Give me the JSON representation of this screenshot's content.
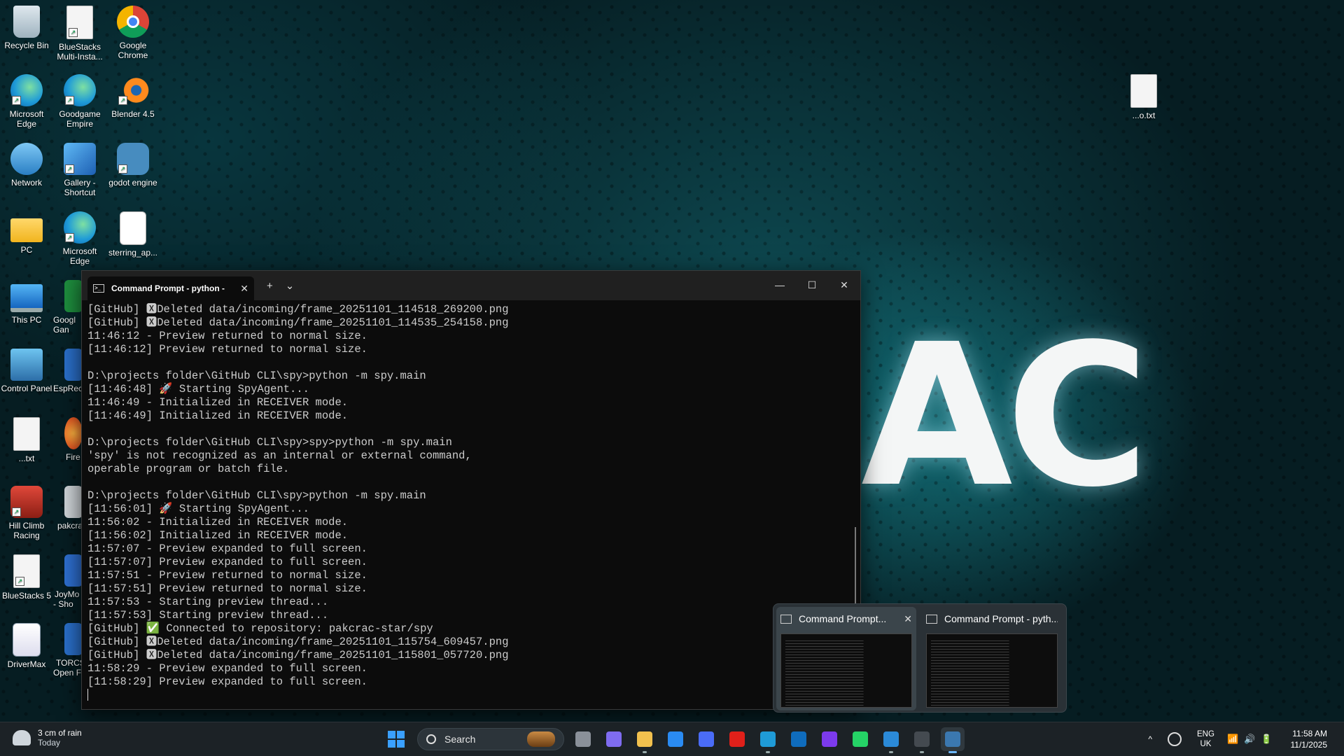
{
  "desktop": {
    "icons": [
      {
        "label": "Recycle Bin",
        "icon": "recycle-bin-icon"
      },
      {
        "label": "BlueStacks Multi-Insta...",
        "icon": "bluestacks-doc-icon"
      },
      {
        "label": "Google Chrome",
        "icon": "chrome-icon"
      },
      {
        "label": "Microsoft Edge",
        "icon": "edge-icon"
      },
      {
        "label": "Goodgame Empire",
        "icon": "edge-icon"
      },
      {
        "label": "Blender 4.5",
        "icon": "blender-icon"
      },
      {
        "label": "Network",
        "icon": "network-icon"
      },
      {
        "label": "Gallery - Shortcut",
        "icon": "gallery-icon"
      },
      {
        "label": "godot engine",
        "icon": "godot-icon"
      },
      {
        "label": "PC",
        "icon": "folder-icon"
      },
      {
        "label": "Microsoft Edge",
        "icon": "edge-icon"
      },
      {
        "label": "sterring_ap...",
        "icon": "python-file-icon"
      },
      {
        "label": "This PC",
        "icon": "this-pc-icon"
      },
      {
        "label": "Googl Gan",
        "icon": "google-games-icon"
      },
      {
        "label": "Control Panel",
        "icon": "control-panel-icon"
      },
      {
        "label": "EspRec",
        "icon": "app-icon"
      },
      {
        "label": "...txt",
        "icon": "text-file-icon"
      },
      {
        "label": "Fire",
        "icon": "firefox-icon"
      },
      {
        "label": "Hill Climb Racing",
        "icon": "hill-climb-icon"
      },
      {
        "label": "pakcra",
        "icon": "settings-file-icon"
      },
      {
        "label": "BlueStacks 5",
        "icon": "text-file-icon"
      },
      {
        "label": "JoyMo - Sho",
        "icon": "app-icon"
      },
      {
        "label": "DriverMax",
        "icon": "drivermax-icon"
      },
      {
        "label": "TORCS Open F",
        "icon": "app-icon"
      },
      {
        "label": "...o.txt",
        "icon": "text-file-icon"
      }
    ],
    "wallpaper_text": "AC"
  },
  "terminal": {
    "tab_title": "Command Prompt - python -",
    "new_tab": "+",
    "dropdown": "⌄",
    "controls": {
      "minimize": "—",
      "maximize": "☐",
      "close": "✕"
    },
    "lines": [
      "[GitHub] 🆇Deleted data/incoming/frame_20251101_114518_269200.png",
      "[GitHub] 🆇Deleted data/incoming/frame_20251101_114535_254158.png",
      "11:46:12 - Preview returned to normal size.",
      "[11:46:12] Preview returned to normal size.",
      "",
      "D:\\projects folder\\GitHub CLI\\spy>python -m spy.main",
      "[11:46:48] 🚀 Starting SpyAgent...",
      "11:46:49 - Initialized in RECEIVER mode.",
      "[11:46:49] Initialized in RECEIVER mode.",
      "",
      "D:\\projects folder\\GitHub CLI\\spy>spy>python -m spy.main",
      "'spy' is not recognized as an internal or external command,",
      "operable program or batch file.",
      "",
      "D:\\projects folder\\GitHub CLI\\spy>python -m spy.main",
      "[11:56:01] 🚀 Starting SpyAgent...",
      "11:56:02 - Initialized in RECEIVER mode.",
      "[11:56:02] Initialized in RECEIVER mode.",
      "11:57:07 - Preview expanded to full screen.",
      "[11:57:07] Preview expanded to full screen.",
      "11:57:51 - Preview returned to normal size.",
      "[11:57:51] Preview returned to normal size.",
      "11:57:53 - Starting preview thread...",
      "[11:57:53] Starting preview thread...",
      "[GitHub] ✅ Connected to repository: pakcrac-star/spy",
      "[GitHub] 🆇Deleted data/incoming/frame_20251101_115754_609457.png",
      "[GitHub] 🆇Deleted data/incoming/frame_20251101_115801_057720.png",
      "11:58:29 - Preview expanded to full screen.",
      "[11:58:29] Preview expanded to full screen."
    ]
  },
  "thumbnails": [
    {
      "title": "Command Prompt...",
      "close": "✕"
    },
    {
      "title": "Command Prompt - pyth..."
    }
  ],
  "taskbar": {
    "weather": {
      "line1": "3 cm of rain",
      "line2": "Today"
    },
    "search_label": "Search",
    "apps": [
      {
        "name": "task-view-icon",
        "color": "#8a9099"
      },
      {
        "name": "copilot-icon",
        "color": "#7f6cf0"
      },
      {
        "name": "file-explorer-icon",
        "color": "#f2c14e"
      },
      {
        "name": "microsoft-store-icon",
        "color": "#2a8bf2"
      },
      {
        "name": "app-icon",
        "color": "#4a6cf7"
      },
      {
        "name": "santander-icon",
        "color": "#e0201a"
      },
      {
        "name": "edge-icon",
        "color": "#1f9bd7"
      },
      {
        "name": "outlook-icon",
        "color": "#0f6cbd"
      },
      {
        "name": "bt-icon",
        "color": "#7c3aed"
      },
      {
        "name": "whatsapp-icon",
        "color": "#25d366"
      },
      {
        "name": "vscode-icon",
        "color": "#2b8ad8"
      },
      {
        "name": "terminal-icon",
        "color": "#444a50"
      },
      {
        "name": "python-icon",
        "color": "#3b78b0"
      }
    ],
    "tray": {
      "chevron": "^",
      "lang_line1": "ENG",
      "lang_line2": "UK",
      "sys_icons": "📶🔊🔋",
      "time": "11:58 AM",
      "date": "11/1/2025"
    }
  }
}
